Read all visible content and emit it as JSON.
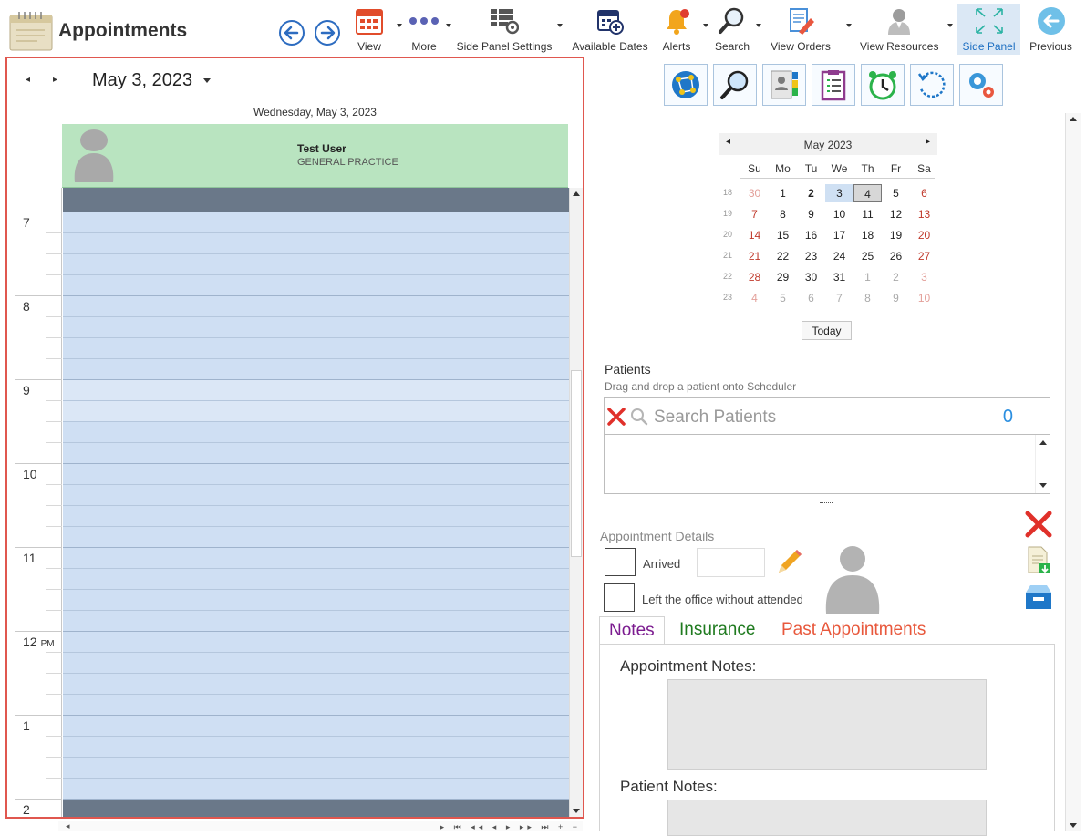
{
  "app": {
    "title": "Appointments"
  },
  "toolbar": {
    "view": "View",
    "more": "More",
    "side_panel_settings": "Side Panel Settings",
    "available_dates": "Available Dates",
    "alerts": "Alerts",
    "search": "Search",
    "view_orders": "View Orders",
    "view_resources": "View Resources",
    "side_panel": "Side Panel",
    "previous": "Previous"
  },
  "scheduler": {
    "nav_prev": "◂",
    "nav_next": "▸",
    "date_title": "May 3, 2023",
    "day_header": "Wednesday, May 3, 2023",
    "resource_name": "Test User",
    "resource_dept": "GENERAL PRACTICE",
    "hours": [
      {
        "label": "7",
        "ampm": ""
      },
      {
        "label": "8",
        "ampm": ""
      },
      {
        "label": "9",
        "ampm": ""
      },
      {
        "label": "10",
        "ampm": ""
      },
      {
        "label": "11",
        "ampm": ""
      },
      {
        "label": "12",
        "ampm": "PM"
      },
      {
        "label": "1",
        "ampm": ""
      },
      {
        "label": "2",
        "ampm": ""
      }
    ]
  },
  "mini_calendar": {
    "title": "May 2023",
    "prev": "◂",
    "next": "▸",
    "dow": [
      "Su",
      "Mo",
      "Tu",
      "We",
      "Th",
      "Fr",
      "Sa"
    ],
    "weeks": [
      {
        "wk": "18",
        "days": [
          "30",
          "1",
          "2",
          "3",
          "4",
          "5",
          "6"
        ]
      },
      {
        "wk": "19",
        "days": [
          "7",
          "8",
          "9",
          "10",
          "11",
          "12",
          "13"
        ]
      },
      {
        "wk": "20",
        "days": [
          "14",
          "15",
          "16",
          "17",
          "18",
          "19",
          "20"
        ]
      },
      {
        "wk": "21",
        "days": [
          "21",
          "22",
          "23",
          "24",
          "25",
          "26",
          "27"
        ]
      },
      {
        "wk": "22",
        "days": [
          "28",
          "29",
          "30",
          "31",
          "1",
          "2",
          "3"
        ]
      },
      {
        "wk": "23",
        "days": [
          "4",
          "5",
          "6",
          "7",
          "8",
          "9",
          "10"
        ]
      }
    ],
    "today_button": "Today"
  },
  "patients": {
    "label": "Patients",
    "hint": "Drag and drop a patient onto Scheduler",
    "search_placeholder": "Search Patients",
    "count": "0"
  },
  "appointment_details": {
    "label": "Appointment Details",
    "arrived_label": "Arrived",
    "left_label": "Left the office without attended"
  },
  "tabs": {
    "notes": "Notes",
    "insurance": "Insurance",
    "past": "Past Appointments"
  },
  "notes": {
    "appointment_notes_label": "Appointment Notes:",
    "patient_notes_label": "Patient Notes:"
  },
  "colors": {
    "accent": "#1e6fc2",
    "resource_bg": "#b9e4c0",
    "slot_bg": "#cfdff3",
    "tab_notes": "#7b1b8f",
    "tab_insurance": "#1f7a1f",
    "tab_past": "#e8583c"
  }
}
